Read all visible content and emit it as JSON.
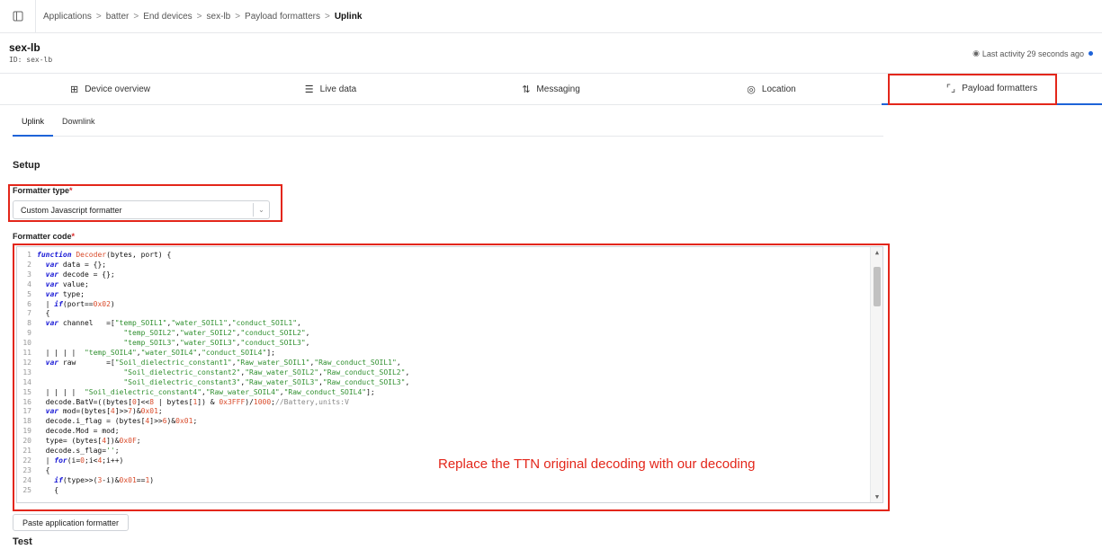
{
  "breadcrumb": [
    "Applications",
    "batter",
    "End devices",
    "sex-lb",
    "Payload formatters",
    "Uplink"
  ],
  "breadcrumb_separator": ">",
  "device": {
    "name": "sex-lb",
    "id_text": "ID: sex-lb",
    "activity": "Last activity 29 seconds ago"
  },
  "tabs": [
    {
      "label": "Device overview",
      "icon": "grid-icon",
      "glyph": "⊞"
    },
    {
      "label": "Live data",
      "icon": "list-icon",
      "glyph": "☰"
    },
    {
      "label": "Messaging",
      "icon": "arrows-icon",
      "glyph": "⇅"
    },
    {
      "label": "Location",
      "icon": "location-icon",
      "glyph": "◎"
    },
    {
      "label": "Payload formatters",
      "icon": "code-icon",
      "glyph": "⌜⌟"
    }
  ],
  "subtabs": [
    "Uplink",
    "Downlink"
  ],
  "setup_title": "Setup",
  "formatter_type_label": "Formatter type",
  "formatter_type_value": "Custom Javascript formatter",
  "formatter_code_label": "Formatter code",
  "required_mark": "*",
  "code_lines": [
    [
      [
        "kw",
        "function "
      ],
      [
        "fn",
        "Decoder"
      ],
      [
        "pl",
        "(bytes, port) {"
      ]
    ],
    [
      [
        "pl",
        "  "
      ],
      [
        "kw",
        "var "
      ],
      [
        "pl",
        "data = {};"
      ]
    ],
    [
      [
        "pl",
        "  "
      ],
      [
        "kw",
        "var "
      ],
      [
        "pl",
        "decode = {};"
      ]
    ],
    [
      [
        "pl",
        "  "
      ],
      [
        "kw",
        "var "
      ],
      [
        "pl",
        "value;"
      ]
    ],
    [
      [
        "pl",
        "  "
      ],
      [
        "kw",
        "var "
      ],
      [
        "pl",
        "type;"
      ]
    ],
    [
      [
        "pl",
        "  | "
      ],
      [
        "kw",
        "if"
      ],
      [
        "pl",
        "(port=="
      ],
      [
        "nm",
        "0x02"
      ],
      [
        "pl",
        ")"
      ]
    ],
    [
      [
        "pl",
        "  {"
      ]
    ],
    [
      [
        "pl",
        "  "
      ],
      [
        "kw",
        "var "
      ],
      [
        "pl",
        "channel   =["
      ],
      [
        "st",
        "\"temp_SOIL1\""
      ],
      [
        "pl",
        ","
      ],
      [
        "st",
        "\"water_SOIL1\""
      ],
      [
        "pl",
        ","
      ],
      [
        "st",
        "\"conduct_SOIL1\""
      ],
      [
        "pl",
        ","
      ]
    ],
    [
      [
        "pl",
        "                    "
      ],
      [
        "st",
        "\"temp_SOIL2\""
      ],
      [
        "pl",
        ","
      ],
      [
        "st",
        "\"water_SOIL2\""
      ],
      [
        "pl",
        ","
      ],
      [
        "st",
        "\"conduct_SOIL2\""
      ],
      [
        "pl",
        ","
      ]
    ],
    [
      [
        "pl",
        "                    "
      ],
      [
        "st",
        "\"temp_SOIL3\""
      ],
      [
        "pl",
        ","
      ],
      [
        "st",
        "\"water_SOIL3\""
      ],
      [
        "pl",
        ","
      ],
      [
        "st",
        "\"conduct_SOIL3\""
      ],
      [
        "pl",
        ","
      ]
    ],
    [
      [
        "pl",
        "  | | | |  "
      ],
      [
        "st",
        "\"temp_SOIL4\""
      ],
      [
        "pl",
        ","
      ],
      [
        "st",
        "\"water_SOIL4\""
      ],
      [
        "pl",
        ","
      ],
      [
        "st",
        "\"conduct_SOIL4\""
      ],
      [
        "pl",
        "];"
      ]
    ],
    [
      [
        "pl",
        "  "
      ],
      [
        "kw",
        "var "
      ],
      [
        "pl",
        "raw       =["
      ],
      [
        "st",
        "\"Soil_dielectric_constant1\""
      ],
      [
        "pl",
        ","
      ],
      [
        "st",
        "\"Raw_water_SOIL1\""
      ],
      [
        "pl",
        ","
      ],
      [
        "st",
        "\"Raw_conduct_SOIL1\""
      ],
      [
        "pl",
        ","
      ]
    ],
    [
      [
        "pl",
        "                    "
      ],
      [
        "st",
        "\"Soil_dielectric_constant2\""
      ],
      [
        "pl",
        ","
      ],
      [
        "st",
        "\"Raw_water_SOIL2\""
      ],
      [
        "pl",
        ","
      ],
      [
        "st",
        "\"Raw_conduct_SOIL2\""
      ],
      [
        "pl",
        ","
      ]
    ],
    [
      [
        "pl",
        "                    "
      ],
      [
        "st",
        "\"Soil_dielectric_constant3\""
      ],
      [
        "pl",
        ","
      ],
      [
        "st",
        "\"Raw_water_SOIL3\""
      ],
      [
        "pl",
        ","
      ],
      [
        "st",
        "\"Raw_conduct_SOIL3\""
      ],
      [
        "pl",
        ","
      ]
    ],
    [
      [
        "pl",
        "  | | | |  "
      ],
      [
        "st",
        "\"Soil_dielectric_constant4\""
      ],
      [
        "pl",
        ","
      ],
      [
        "st",
        "\"Raw_water_SOIL4\""
      ],
      [
        "pl",
        ","
      ],
      [
        "st",
        "\"Raw_conduct_SOIL4\""
      ],
      [
        "pl",
        "];"
      ]
    ],
    [
      [
        "pl",
        "  decode.BatV=((bytes["
      ],
      [
        "nm",
        "0"
      ],
      [
        "pl",
        "]<<"
      ],
      [
        "nm",
        "8"
      ],
      [
        "pl",
        " | bytes["
      ],
      [
        "nm",
        "1"
      ],
      [
        "pl",
        "]) & "
      ],
      [
        "nm",
        "0x3FFF"
      ],
      [
        "pl",
        ")/"
      ],
      [
        "nm",
        "1000"
      ],
      [
        "pl",
        ";"
      ],
      [
        "cm",
        "//Battery,units:V"
      ]
    ],
    [
      [
        "pl",
        "  "
      ],
      [
        "kw",
        "var "
      ],
      [
        "pl",
        "mod=(bytes["
      ],
      [
        "nm",
        "4"
      ],
      [
        "pl",
        "]>>"
      ],
      [
        "nm",
        "7"
      ],
      [
        "pl",
        ")&"
      ],
      [
        "nm",
        "0x01"
      ],
      [
        "pl",
        ";"
      ]
    ],
    [
      [
        "pl",
        "  decode.i_flag = (bytes["
      ],
      [
        "nm",
        "4"
      ],
      [
        "pl",
        "]>>"
      ],
      [
        "nm",
        "6"
      ],
      [
        "pl",
        ")&"
      ],
      [
        "nm",
        "0x01"
      ],
      [
        "pl",
        ";"
      ]
    ],
    [
      [
        "pl",
        "  decode.Mod = mod;"
      ]
    ],
    [
      [
        "pl",
        "  type= (bytes["
      ],
      [
        "nm",
        "4"
      ],
      [
        "pl",
        "])&"
      ],
      [
        "nm",
        "0x0F"
      ],
      [
        "pl",
        ";"
      ]
    ],
    [
      [
        "pl",
        "  decode.s_flag="
      ],
      [
        "st",
        "''"
      ],
      [
        "pl",
        ";"
      ]
    ],
    [
      [
        "pl",
        "  | "
      ],
      [
        "kw",
        "for"
      ],
      [
        "pl",
        "(i="
      ],
      [
        "nm",
        "0"
      ],
      [
        "pl",
        ";i<"
      ],
      [
        "nm",
        "4"
      ],
      [
        "pl",
        ";i++)"
      ]
    ],
    [
      [
        "pl",
        "  {"
      ]
    ],
    [
      [
        "pl",
        "    "
      ],
      [
        "kw",
        "if"
      ],
      [
        "pl",
        "(type>>("
      ],
      [
        "nm",
        "3"
      ],
      [
        "pl",
        "-i)&"
      ],
      [
        "nm",
        "0x01"
      ],
      [
        "pl",
        "=="
      ],
      [
        "nm",
        "1"
      ],
      [
        "pl",
        ")"
      ]
    ],
    [
      [
        "pl",
        "    {"
      ]
    ]
  ],
  "annotation_text": "Replace the TTN original decoding with our decoding",
  "paste_button_label": "Paste application formatter",
  "test_title": "Test",
  "colors": {
    "accent": "#1e63d8",
    "annotation_red": "#e3261a",
    "keyword": "#1a1ad6",
    "string": "#2f8f2f",
    "number": "#d94b2b"
  }
}
